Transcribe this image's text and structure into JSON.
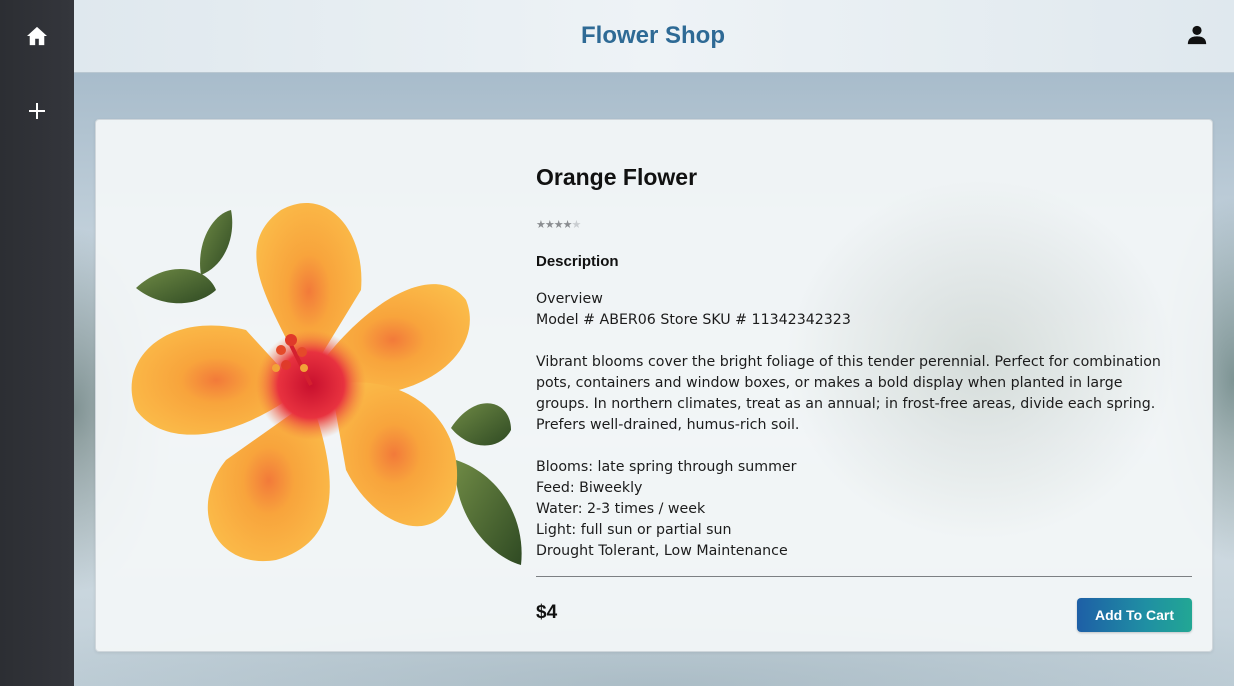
{
  "app": {
    "title": "Flower Shop"
  },
  "sidebar": {
    "items": [
      {
        "icon": "home-icon"
      },
      {
        "icon": "plus-icon"
      }
    ]
  },
  "header": {
    "user_icon": "user-icon"
  },
  "product": {
    "name": "Orange Flower",
    "rating": 4,
    "rating_max": 5,
    "description_heading": "Description",
    "overview_label": "Overview",
    "model_line": "Model # ABER06 Store SKU # 11342342323",
    "summary": "Vibrant blooms cover the bright foliage of this tender perennial. Perfect for combination pots, containers and window boxes, or makes a bold display when planted in large groups. In northern climates, treat as an annual; in frost-free areas, divide each spring. Prefers well-drained, humus-rich soil.",
    "details": [
      "Blooms: late spring through summer",
      "Feed: Biweekly",
      "Water: 2-3 times / week",
      "Light: full sun or partial sun",
      "Drought Tolerant, Low Maintenance"
    ],
    "price": "$4",
    "add_to_cart_label": "Add To Cart"
  },
  "colors": {
    "title": "#2e6a95",
    "sidebar": "#2c2e33",
    "button_start": "#1e5fa6",
    "button_end": "#22a794",
    "flower": "#f7a63a"
  }
}
